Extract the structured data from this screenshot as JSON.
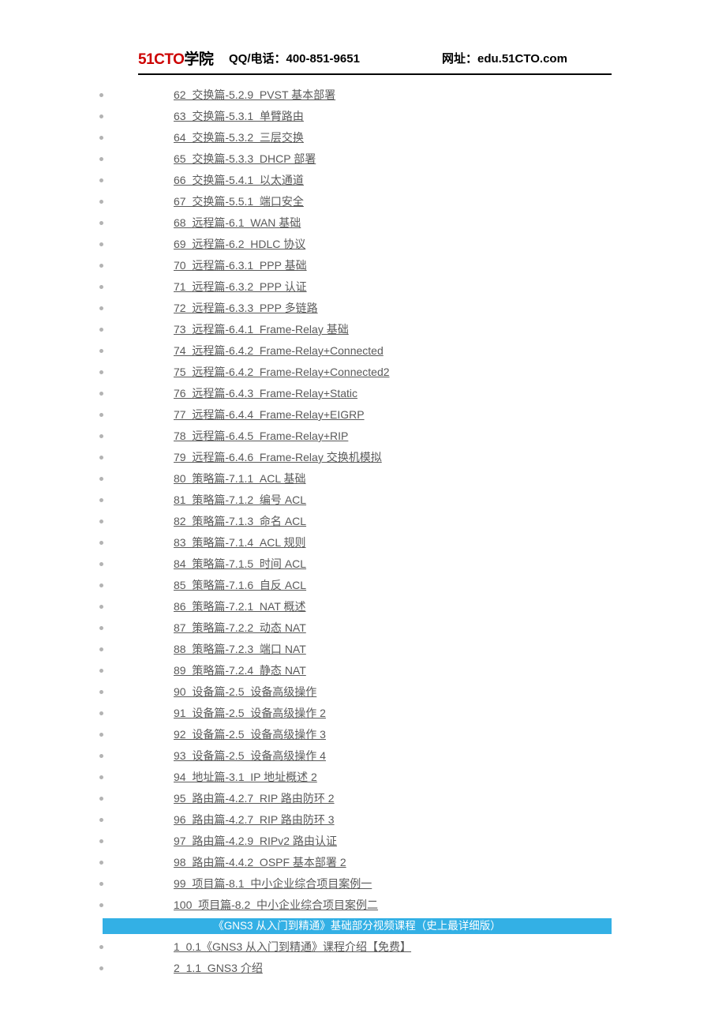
{
  "header": {
    "logo_brand": "51CTO",
    "logo_suffix": "学院",
    "qq_label": "QQ/电话：400-851-9651",
    "site_label": "网址：edu.51CTO.com"
  },
  "list1": [
    "62  交换篇-5.2.9  PVST 基本部署",
    "63  交换篇-5.3.1  单臂路由",
    "64  交换篇-5.3.2  三层交换",
    "65  交换篇-5.3.3  DHCP 部署",
    "66  交换篇-5.4.1  以太通道",
    "67  交换篇-5.5.1  端口安全",
    "68  远程篇-6.1  WAN 基础",
    "69  远程篇-6.2  HDLC 协议",
    "70  远程篇-6.3.1  PPP 基础",
    "71  远程篇-6.3.2  PPP 认证",
    "72  远程篇-6.3.3  PPP 多链路",
    "73  远程篇-6.4.1  Frame-Relay 基础",
    "74  远程篇-6.4.2  Frame-Relay+Connected",
    "75  远程篇-6.4.2  Frame-Relay+Connected2",
    "76  远程篇-6.4.3  Frame-Relay+Static",
    "77  远程篇-6.4.4  Frame-Relay+EIGRP",
    "78  远程篇-6.4.5  Frame-Relay+RIP",
    "79  远程篇-6.4.6  Frame-Relay 交换机模拟",
    "80  策略篇-7.1.1  ACL 基础",
    "81  策略篇-7.1.2  编号 ACL",
    "82  策略篇-7.1.3  命名 ACL",
    "83  策略篇-7.1.4  ACL 规则",
    "84  策略篇-7.1.5  时间 ACL",
    "85  策略篇-7.1.6  自反 ACL",
    "86  策略篇-7.2.1  NAT 概述",
    "87  策略篇-7.2.2  动态 NAT",
    "88  策略篇-7.2.3  端口 NAT",
    "89  策略篇-7.2.4  静态 NAT",
    "90  设备篇-2.5  设备高级操作",
    "91  设备篇-2.5  设备高级操作 2",
    "92  设备篇-2.5  设备高级操作 3",
    "93  设备篇-2.5  设备高级操作 4",
    "94  地址篇-3.1  IP 地址概述 2",
    "95  路由篇-4.2.7  RIP 路由防环 2",
    "96  路由篇-4.2.7  RIP 路由防环 3",
    "97  路由篇-4.2.9  RIPv2 路由认证",
    "98  路由篇-4.4.2  OSPF 基本部署 2",
    "99  项目篇-8.1  中小企业综合项目案例一",
    "100  项目篇-8.2  中小企业综合项目案例二"
  ],
  "section_title": "《GNS3 从入门到精通》基础部分视频课程（史上最详细版）",
  "list2": [
    "1  0.1《GNS3 从入门到精通》课程介绍【免费】",
    "2  1.1  GNS3 介绍"
  ]
}
